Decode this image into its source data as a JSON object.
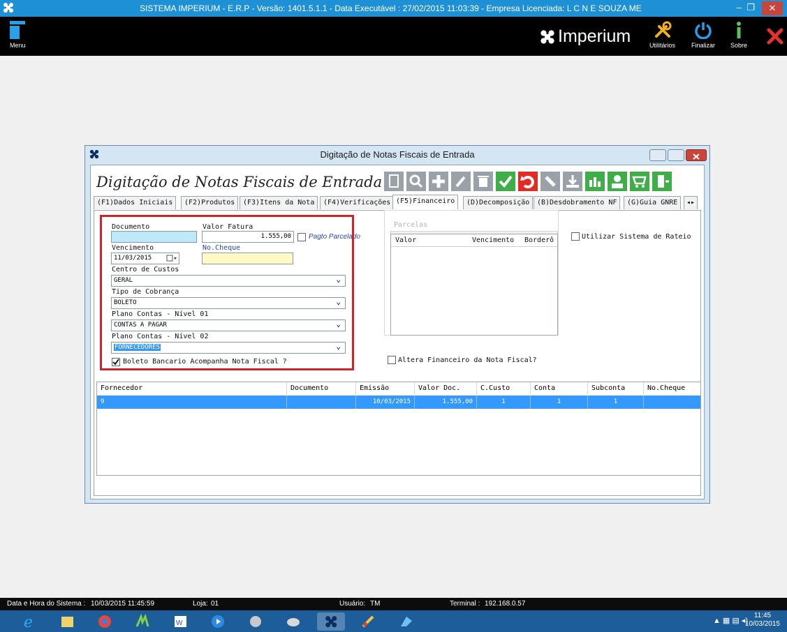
{
  "window": {
    "title": "SISTEMA IMPERIUM - E.R.P - Versão: 1401.5.1.1 - Data Executável : 27/02/2015 11:03:39 - Empresa Licenciada: L C N E SOUZA ME",
    "minimize": "–",
    "maximize": "❐",
    "close": "✕"
  },
  "topbar": {
    "menu_label": "Menu",
    "brand": "Imperium",
    "utilitarios_label": "Utilitários",
    "finalizar_label": "Finalizar",
    "sobre_label": "Sobre"
  },
  "dialog": {
    "title": "Digitação de Notas Fiscais de Entrada",
    "heading": "Digitação de Notas Fiscais de Entrada",
    "tabs": [
      {
        "label": "(F1)Dados Iniciais"
      },
      {
        "label": "(F2)Produtos"
      },
      {
        "label": "(F3)Itens da Nota"
      },
      {
        "label": "(F4)Verificações"
      },
      {
        "label": "(F5)Financeiro"
      },
      {
        "label": "(D)Decomposição"
      },
      {
        "label": "(B)Desdobramento NF"
      },
      {
        "label": "(G)Guia GNRE"
      }
    ],
    "tab_scroll": "◂▸"
  },
  "form": {
    "documento_label": "Documento",
    "documento_value": "",
    "valor_fatura_label": "Valor Fatura",
    "valor_fatura_value": "1.555,00",
    "pagto_parcelado_label": "Pagto Parcelado",
    "vencimento_label": "Vencimento",
    "vencimento_value": "11/03/2015",
    "no_cheque_label": "No.Cheque",
    "no_cheque_value": "",
    "centro_custos_label": "Centro de Custos",
    "centro_custos_value": "GERAL",
    "tipo_cobranca_label": "Tipo de Cobrança",
    "tipo_cobranca_value": "BOLETO",
    "plano_n1_label": "Plano Contas - Nível 01",
    "plano_n1_value": "CONTAS A PAGAR",
    "plano_n2_label": "Plano Contas - Nível 02",
    "plano_n2_value": "FORNECEDORES",
    "boleto_label": "Boleto Bancario Acompanha Nota Fiscal ?",
    "boleto_checked": true,
    "parcelas_label": "Parcelas",
    "parcelas_headers": [
      "Valor",
      "Vencimento",
      "Borderô"
    ],
    "rateio_label": "Utilizar Sistema de Rateio",
    "altera_label": "Altera Financeiro da Nota Fiscal?"
  },
  "grid": {
    "headers": [
      "Fornecedor",
      "Documento",
      "Emissão",
      "Valor Doc.",
      "C.Custo",
      "Conta",
      "Subconta",
      "No.Cheque"
    ],
    "rows": [
      {
        "fornecedor": "9",
        "documento": "",
        "emissao": "10/03/2015",
        "valor_doc": "1.555,00",
        "c_custo": "1",
        "conta": "1",
        "subconta": "1",
        "no_cheque": ""
      }
    ]
  },
  "statusbar": {
    "datahora_label": "Data e Hora do Sistema :",
    "datahora_value": "10/03/2015 11:45:59",
    "loja_label": "Loja:",
    "loja_value": "01",
    "usuario_label": "Usuário:",
    "usuario_value": "TM",
    "terminal_label": "Terminal :",
    "terminal_value": "192.168.0.57"
  },
  "taskbar": {
    "time": "11:45",
    "date": "10/03/2015"
  },
  "colors": {
    "title_bar": "#1e90d6",
    "highlight_box": "#d2232a",
    "selected_row": "#3399ff",
    "field_cyan": "#bfe8f8",
    "field_yellow": "#fff9c4"
  }
}
